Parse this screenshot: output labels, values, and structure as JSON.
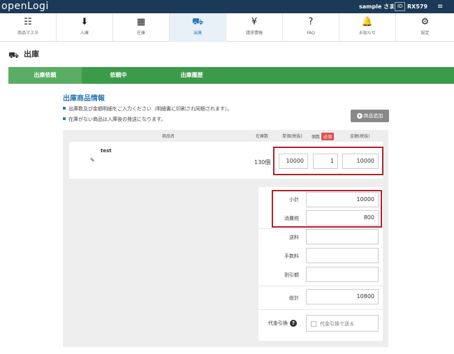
{
  "header": {
    "logo": "openLogi",
    "user": "sample さま",
    "id_label": "ID",
    "id_value": "RX579",
    "menu_icon": "hamburger-icon"
  },
  "nav": [
    {
      "label": "商品マスタ",
      "icon": "product-master-icon",
      "glyph": "☷",
      "active": false
    },
    {
      "label": "入庫",
      "icon": "box-in-icon",
      "glyph": "⬇",
      "active": false
    },
    {
      "label": "在庫",
      "icon": "inventory-icon",
      "glyph": "▦",
      "active": false
    },
    {
      "label": "出庫",
      "icon": "truck-icon",
      "glyph": "⛟",
      "active": true
    },
    {
      "label": "請求情報",
      "icon": "yen-icon",
      "glyph": "¥",
      "active": false
    },
    {
      "label": "FAQ",
      "icon": "question-icon",
      "glyph": "?",
      "active": false
    },
    {
      "label": "お知らせ",
      "icon": "bell-icon",
      "glyph": "🔔",
      "active": false
    },
    {
      "label": "設定",
      "icon": "gear-icon",
      "glyph": "⚙",
      "active": false
    }
  ],
  "page": {
    "title": "出庫"
  },
  "tabs": [
    {
      "label": "出庫依頼",
      "active": true
    },
    {
      "label": "依頼中",
      "active": false
    },
    {
      "label": "出庫履歴",
      "active": false
    }
  ],
  "section": {
    "title": "出庫商品情報",
    "note1": "出庫数及び金額明細をご入力ください（明細書に印刷され同梱されます）。",
    "note2": "在庫がない商品は入庫後の発送になります。",
    "add_button": "商品追加"
  },
  "table": {
    "headers": {
      "name": "商品名",
      "stock": "在庫数",
      "unit_price": "単価(税抜)",
      "quantity": "個数",
      "required": "必須",
      "amount": "金額(税抜)"
    },
    "rows": [
      {
        "name": "test",
        "stock": "130個",
        "unit_price": "10000",
        "quantity": "1",
        "amount": "10000"
      }
    ]
  },
  "summary": {
    "subtotal_label": "小計",
    "subtotal": "10000",
    "tax_label": "消費税",
    "tax": "800",
    "shipping_label": "送料",
    "shipping": "",
    "fee_label": "手数料",
    "fee": "",
    "discount_label": "割引額",
    "discount": "",
    "total_label": "総計",
    "total": "10800",
    "cod_label": "代金引換",
    "cod_checkbox": "代金引換で送る"
  },
  "colors": {
    "topbar": "#1b3a57",
    "tab_green": "#3c9b4a",
    "accent_blue": "#2a78b9",
    "highlight_red": "#b0232a"
  }
}
